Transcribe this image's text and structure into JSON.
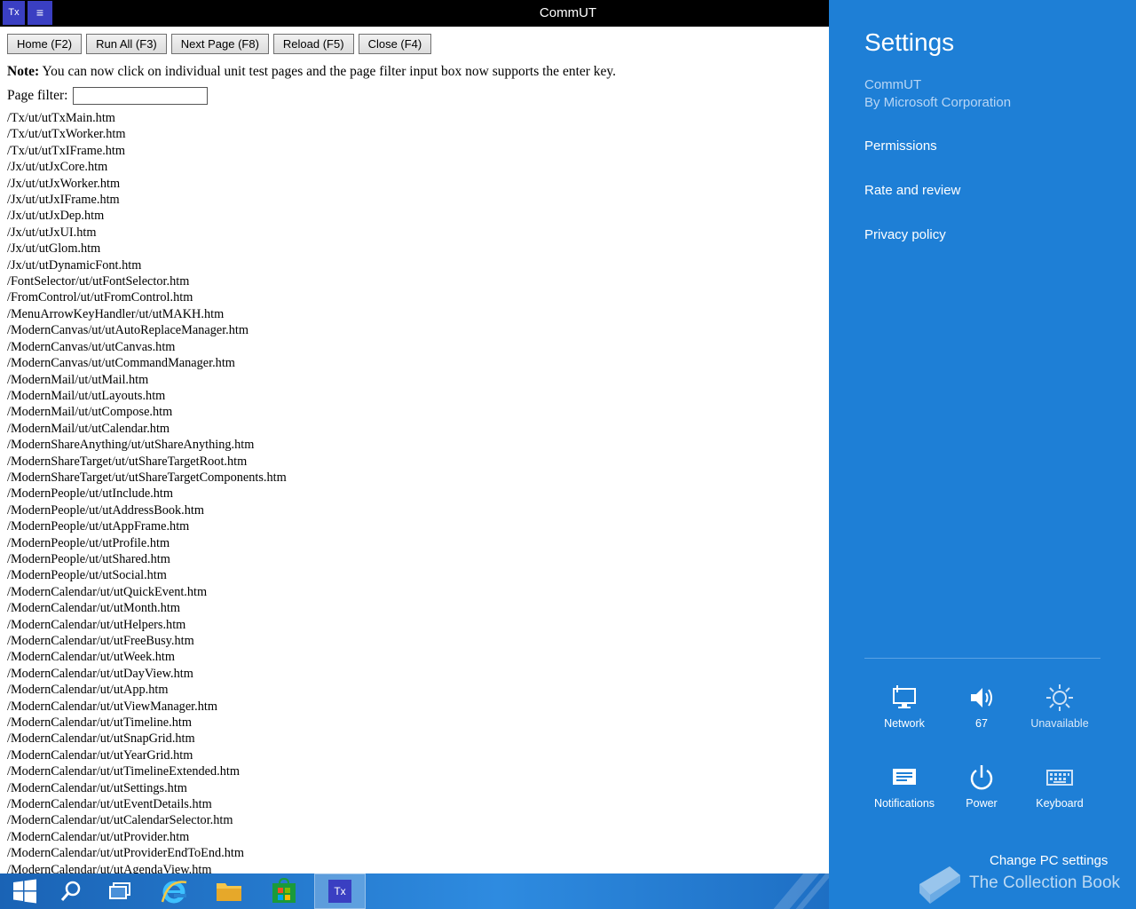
{
  "window": {
    "title": "CommUT",
    "app_icon_label": "Tx",
    "menu_icon": "≡"
  },
  "toolbar": {
    "buttons": [
      {
        "label": "Home (F2)"
      },
      {
        "label": "Run All (F3)"
      },
      {
        "label": "Next Page (F8)"
      },
      {
        "label": "Reload (F5)"
      },
      {
        "label": "Close (F4)"
      }
    ]
  },
  "note": {
    "label": "Note:",
    "text": "You can now click on individual unit test pages and the page filter input box now supports the enter key."
  },
  "filter": {
    "label": "Page filter:",
    "value": ""
  },
  "pages": [
    "/Tx/ut/utTxMain.htm",
    "/Tx/ut/utTxWorker.htm",
    "/Tx/ut/utTxIFrame.htm",
    "/Jx/ut/utJxCore.htm",
    "/Jx/ut/utJxWorker.htm",
    "/Jx/ut/utJxIFrame.htm",
    "/Jx/ut/utJxDep.htm",
    "/Jx/ut/utJxUI.htm",
    "/Jx/ut/utGlom.htm",
    "/Jx/ut/utDynamicFont.htm",
    "/FontSelector/ut/utFontSelector.htm",
    "/FromControl/ut/utFromControl.htm",
    "/MenuArrowKeyHandler/ut/utMAKH.htm",
    "/ModernCanvas/ut/utAutoReplaceManager.htm",
    "/ModernCanvas/ut/utCanvas.htm",
    "/ModernCanvas/ut/utCommandManager.htm",
    "/ModernMail/ut/utMail.htm",
    "/ModernMail/ut/utLayouts.htm",
    "/ModernMail/ut/utCompose.htm",
    "/ModernMail/ut/utCalendar.htm",
    "/ModernShareAnything/ut/utShareAnything.htm",
    "/ModernShareTarget/ut/utShareTargetRoot.htm",
    "/ModernShareTarget/ut/utShareTargetComponents.htm",
    "/ModernPeople/ut/utInclude.htm",
    "/ModernPeople/ut/utAddressBook.htm",
    "/ModernPeople/ut/utAppFrame.htm",
    "/ModernPeople/ut/utProfile.htm",
    "/ModernPeople/ut/utShared.htm",
    "/ModernPeople/ut/utSocial.htm",
    "/ModernCalendar/ut/utQuickEvent.htm",
    "/ModernCalendar/ut/utMonth.htm",
    "/ModernCalendar/ut/utHelpers.htm",
    "/ModernCalendar/ut/utFreeBusy.htm",
    "/ModernCalendar/ut/utWeek.htm",
    "/ModernCalendar/ut/utDayView.htm",
    "/ModernCalendar/ut/utApp.htm",
    "/ModernCalendar/ut/utViewManager.htm",
    "/ModernCalendar/ut/utTimeline.htm",
    "/ModernCalendar/ut/utSnapGrid.htm",
    "/ModernCalendar/ut/utYearGrid.htm",
    "/ModernCalendar/ut/utTimelineExtended.htm",
    "/ModernCalendar/ut/utSettings.htm",
    "/ModernCalendar/ut/utEventDetails.htm",
    "/ModernCalendar/ut/utCalendarSelector.htm",
    "/ModernCalendar/ut/utProvider.htm",
    "/ModernCalendar/ut/utProviderEndToEnd.htm",
    "/ModernCalendar/ut/utAgendaView.htm"
  ],
  "settings": {
    "title": "Settings",
    "app_name": "CommUT",
    "publisher": "By Microsoft Corporation",
    "links": {
      "permissions": "Permissions",
      "rate_review": "Rate and review",
      "privacy": "Privacy policy"
    },
    "tiles": {
      "network": "Network",
      "volume": "67",
      "brightness": "Unavailable",
      "notifications": "Notifications",
      "power": "Power",
      "keyboard": "Keyboard"
    },
    "change_pc_settings": "Change PC settings",
    "watermark": "The Collection Book"
  },
  "taskbar": {
    "active_app_label": "Tx"
  },
  "colors": {
    "charm_bg": "#1e7fd6",
    "app_accent": "#3a3fc2"
  }
}
